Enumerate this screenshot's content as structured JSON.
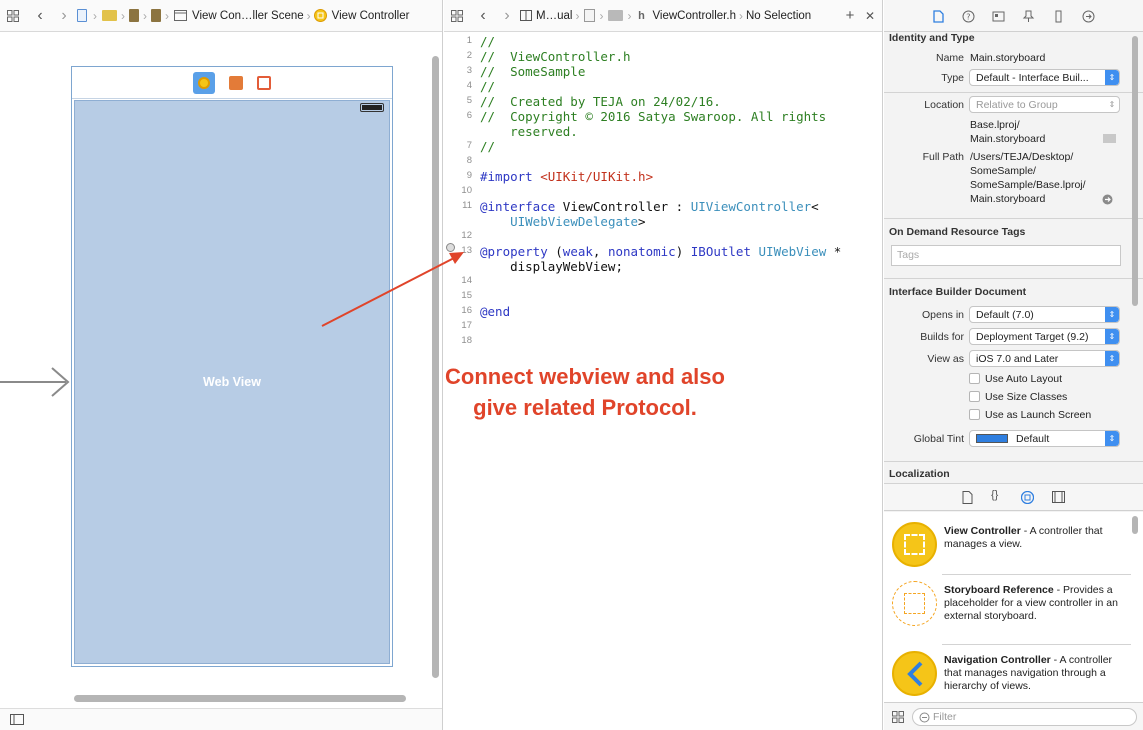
{
  "storyboard_jumpbar": {
    "items": [
      "View Con…ller Scene",
      "View Controller"
    ]
  },
  "scene": {
    "webview_label": "Web View"
  },
  "editor_jumpbar": {
    "items": [
      "M…ual",
      "ViewController.h",
      "No Selection"
    ]
  },
  "code": {
    "lines": [
      {
        "n": "1",
        "parts": [
          {
            "c": "cm",
            "t": "//"
          }
        ]
      },
      {
        "n": "2",
        "parts": [
          {
            "c": "cm",
            "t": "//  ViewController.h"
          }
        ]
      },
      {
        "n": "3",
        "parts": [
          {
            "c": "cm",
            "t": "//  SomeSample"
          }
        ]
      },
      {
        "n": "4",
        "parts": [
          {
            "c": "cm",
            "t": "//"
          }
        ]
      },
      {
        "n": "5",
        "parts": [
          {
            "c": "cm",
            "t": "//  Created by TEJA on 24/02/16."
          }
        ]
      },
      {
        "n": "6",
        "parts": [
          {
            "c": "cm",
            "t": "//  Copyright © 2016 Satya Swaroop. All rights"
          }
        ]
      },
      {
        "n": "",
        "parts": [
          {
            "c": "cm",
            "t": "    reserved."
          }
        ]
      },
      {
        "n": "7",
        "parts": [
          {
            "c": "cm",
            "t": "//"
          }
        ]
      },
      {
        "n": "8",
        "parts": []
      },
      {
        "n": "9",
        "parts": [
          {
            "c": "kw",
            "t": "#import "
          },
          {
            "c": "st",
            "t": "<UIKit/UIKit.h>"
          }
        ]
      },
      {
        "n": "10",
        "parts": []
      },
      {
        "n": "11",
        "parts": [
          {
            "c": "kw",
            "t": "@interface"
          },
          {
            "c": "pl",
            "t": " ViewController : "
          },
          {
            "c": "ty",
            "t": "UIViewController"
          },
          {
            "c": "pl",
            "t": "<"
          }
        ]
      },
      {
        "n": "",
        "parts": [
          {
            "c": "pl",
            "t": "    "
          },
          {
            "c": "ty",
            "t": "UIWebViewDelegate"
          },
          {
            "c": "pl",
            "t": ">"
          }
        ]
      },
      {
        "n": "12",
        "parts": []
      },
      {
        "n": "13",
        "parts": [
          {
            "c": "kw",
            "t": "@property"
          },
          {
            "c": "pl",
            "t": " ("
          },
          {
            "c": "kw",
            "t": "weak"
          },
          {
            "c": "pl",
            "t": ", "
          },
          {
            "c": "kw",
            "t": "nonatomic"
          },
          {
            "c": "pl",
            "t": ") "
          },
          {
            "c": "kw",
            "t": "IBOutlet"
          },
          {
            "c": "pl",
            "t": " "
          },
          {
            "c": "ty",
            "t": "UIWebView"
          },
          {
            "c": "pl",
            "t": " *"
          }
        ]
      },
      {
        "n": "",
        "parts": [
          {
            "c": "pl",
            "t": "    displayWebView;"
          }
        ]
      },
      {
        "n": "14",
        "parts": []
      },
      {
        "n": "15",
        "parts": []
      },
      {
        "n": "16",
        "parts": [
          {
            "c": "kw",
            "t": "@end"
          }
        ]
      },
      {
        "n": "17",
        "parts": []
      },
      {
        "n": "18",
        "parts": []
      }
    ]
  },
  "annotation": {
    "line1": "Connect webview and also",
    "line2": "give related Protocol."
  },
  "inspector": {
    "identity": {
      "title": "Identity and Type",
      "name_label": "Name",
      "name_value": "Main.storyboard",
      "type_label": "Type",
      "type_value": "Default - Interface Buil...",
      "location_label": "Location",
      "location_value": "Relative to Group",
      "location_path1": "Base.lproj/",
      "location_path2": "Main.storyboard",
      "fullpath_label": "Full Path",
      "fullpath1": "/Users/TEJA/Desktop/",
      "fullpath2": "SomeSample/",
      "fullpath3": "SomeSample/Base.lproj/",
      "fullpath4": "Main.storyboard"
    },
    "odr": {
      "title": "On Demand Resource Tags",
      "placeholder": "Tags"
    },
    "ibdoc": {
      "title": "Interface Builder Document",
      "opens_label": "Opens in",
      "opens_value": "Default (7.0)",
      "builds_label": "Builds for",
      "builds_value": "Deployment Target (9.2)",
      "viewas_label": "View as",
      "viewas_value": "iOS 7.0 and Later",
      "check1": "Use Auto Layout",
      "check2": "Use Size Classes",
      "check3": "Use as Launch Screen",
      "tint_label": "Global Tint",
      "tint_value": "Default",
      "tint_color": "#2f7fe0"
    },
    "localization": {
      "title": "Localization"
    },
    "library": {
      "items": [
        {
          "title": "View Controller",
          "desc": " - A controller that manages a view."
        },
        {
          "title": "Storyboard Reference",
          "desc": " - Provides a placeholder for a view controller in an external storyboard."
        },
        {
          "title": "Navigation Controller",
          "desc": " - A controller that manages navigation through a hierarchy of views."
        }
      ],
      "filter_placeholder": "Filter"
    }
  },
  "colors": {
    "accent": "#3f8ff0",
    "annotation": "#e0442a",
    "webview_bg": "#b7cce5",
    "library_yellow": "#f5c518"
  }
}
